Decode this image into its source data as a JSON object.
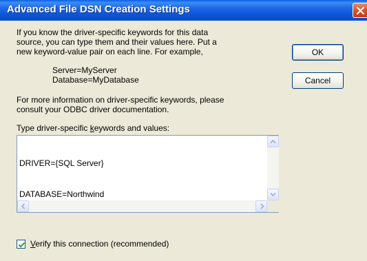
{
  "window": {
    "title": "Advanced File DSN Creation Settings"
  },
  "intro": {
    "line1": "If you know the driver-specific keywords for this data",
    "line2": "source, you can type them and their values here.  Put a",
    "line3": "new keyword-value pair on each line.  For example,"
  },
  "example": {
    "line1": "Server=MyServer",
    "line2": "Database=MyDatabase"
  },
  "more_info": {
    "line1": "For more information on driver-specific keywords, please",
    "line2": "consult your ODBC driver documentation."
  },
  "keywords_label": {
    "before": "Type driver-specific ",
    "accel": "k",
    "after": "eywords and values:"
  },
  "keywords_box": {
    "lines": [
      "DRIVER={SQL Server}",
      "DATABASE=Northwind"
    ]
  },
  "buttons": {
    "ok": "OK",
    "cancel": "Cancel"
  },
  "verify": {
    "checked": true,
    "accel": "V",
    "label_rest": "erify this connection (recommended)"
  },
  "icons": {
    "close": "close-icon",
    "scroll_up": "arrow-up-icon",
    "scroll_down": "arrow-down-icon",
    "scroll_left": "arrow-left-icon",
    "scroll_right": "arrow-right-icon",
    "check": "check-icon"
  }
}
